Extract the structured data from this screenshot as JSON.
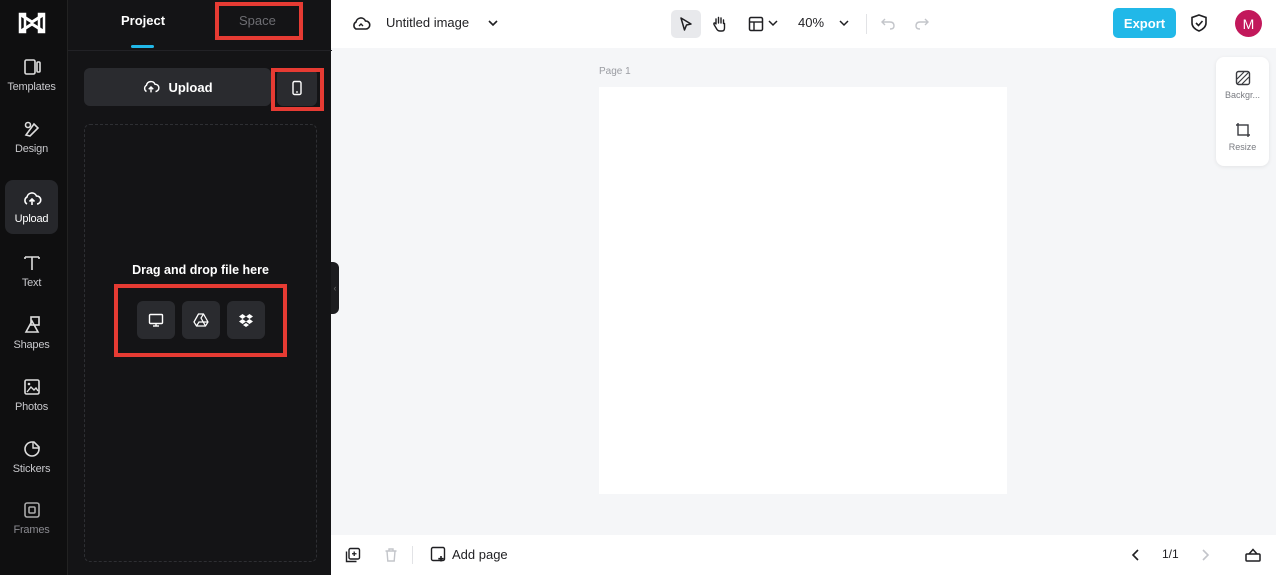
{
  "sidebar": {
    "items": [
      {
        "label": "Templates",
        "icon": "templates-icon"
      },
      {
        "label": "Design",
        "icon": "design-icon"
      },
      {
        "label": "Upload",
        "icon": "upload-cloud-icon",
        "active": true
      },
      {
        "label": "Text",
        "icon": "text-icon"
      },
      {
        "label": "Shapes",
        "icon": "shapes-icon"
      },
      {
        "label": "Photos",
        "icon": "photos-icon"
      },
      {
        "label": "Stickers",
        "icon": "stickers-icon"
      },
      {
        "label": "Frames",
        "icon": "frames-icon"
      }
    ]
  },
  "panel": {
    "tabs": [
      {
        "label": "Project",
        "active": true
      },
      {
        "label": "Space",
        "active": false
      }
    ],
    "upload_label": "Upload",
    "drop_text": "Drag and drop file here",
    "sources": [
      "computer-icon",
      "google-drive-icon",
      "dropbox-icon"
    ]
  },
  "topbar": {
    "title": "Untitled image",
    "zoom": "40%",
    "export_label": "Export",
    "avatar_initial": "M"
  },
  "canvas": {
    "page_label": "Page 1"
  },
  "side_tools": [
    {
      "label": "Backgr...",
      "icon": "background-icon"
    },
    {
      "label": "Resize",
      "icon": "resize-icon"
    }
  ],
  "bottombar": {
    "add_page_label": "Add page",
    "pager": "1/1"
  },
  "colors": {
    "accent": "#21b8e8",
    "highlight": "#e63b33",
    "avatar": "#c2185b",
    "rail_bg": "#0f0f10",
    "panel_bg": "#141416"
  }
}
